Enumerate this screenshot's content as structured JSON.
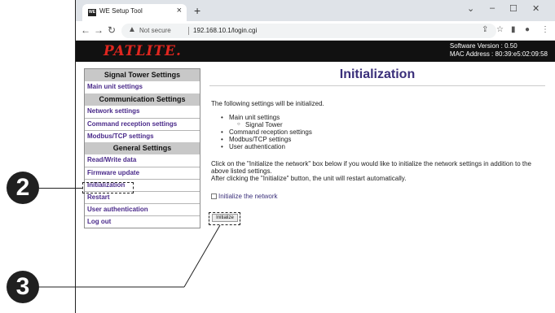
{
  "browser": {
    "tab_title": "WE Setup Tool",
    "tab_close": "×",
    "new_tab": "+",
    "favicon_text": "WE",
    "win_minimize": "–",
    "win_maximize": "☐",
    "win_close": "✕",
    "win_chevron": "⌄",
    "not_secure": "Not secure",
    "url": "192.168.10.1/login.cgi"
  },
  "header": {
    "logo": "PATLITE.",
    "software_version": "Software Version : 0.50",
    "mac_address": "MAC Address : 80:39:e5:02:09:58"
  },
  "sidebar": {
    "sections": [
      {
        "title": "Signal Tower Settings",
        "items": [
          "Main unit settings"
        ]
      },
      {
        "title": "Communication Settings",
        "items": [
          "Network settings",
          "Command reception settings",
          "Modbus/TCP settings"
        ]
      },
      {
        "title": "General Settings",
        "items": [
          "Read/Write data",
          "Firmware update",
          "Initialization",
          "Restart",
          "User authentication",
          "Log out"
        ]
      }
    ]
  },
  "main": {
    "title": "Initialization",
    "intro": "The following settings will be initialized.",
    "list": [
      "Main unit settings",
      "Signal Tower",
      "Command reception settings",
      "Modbus/TCP settings",
      "User authentication"
    ],
    "para1": "Click on the \"Initialize the network\" box below if you would like to initialize the network settings in addition to the above listed settings.",
    "para2": "After clicking the \"Initialize\" button, the unit will restart automatically.",
    "checkbox_label": "Initialize the network",
    "button": "Initialize"
  },
  "annotations": {
    "callout_2": "2",
    "callout_3": "3"
  }
}
